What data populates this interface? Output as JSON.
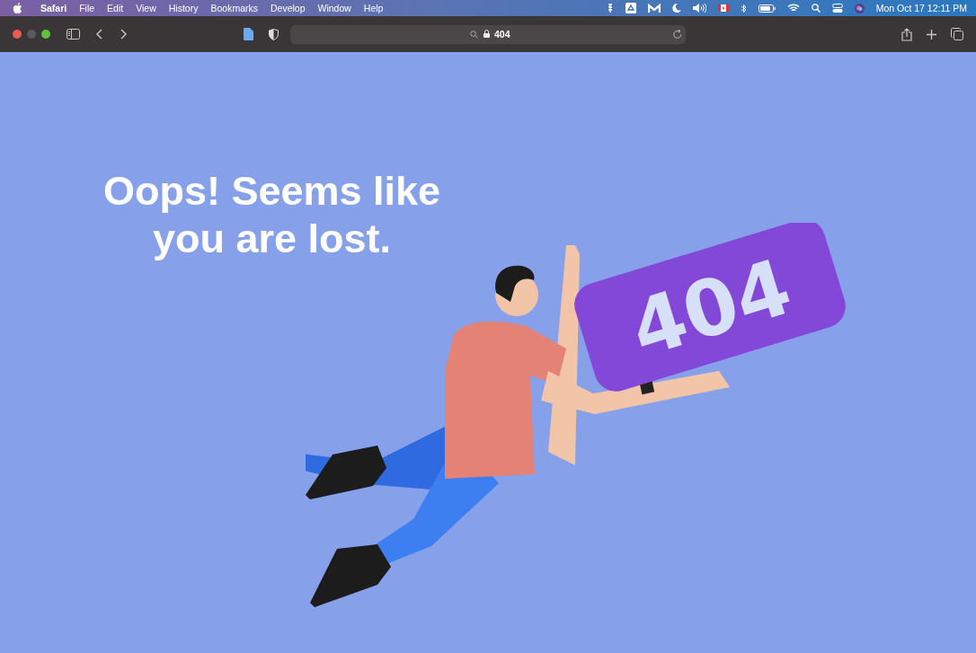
{
  "menu_bar": {
    "app_name": "Safari",
    "items": [
      "File",
      "Edit",
      "View",
      "History",
      "Bookmarks",
      "Develop",
      "Window",
      "Help"
    ],
    "clock": "Mon Oct 17  12:11 PM"
  },
  "toolbar": {
    "address": "404"
  },
  "page": {
    "heading_lines": [
      "Oops! Seems like",
      "you are lost."
    ],
    "sign_text": "404"
  }
}
